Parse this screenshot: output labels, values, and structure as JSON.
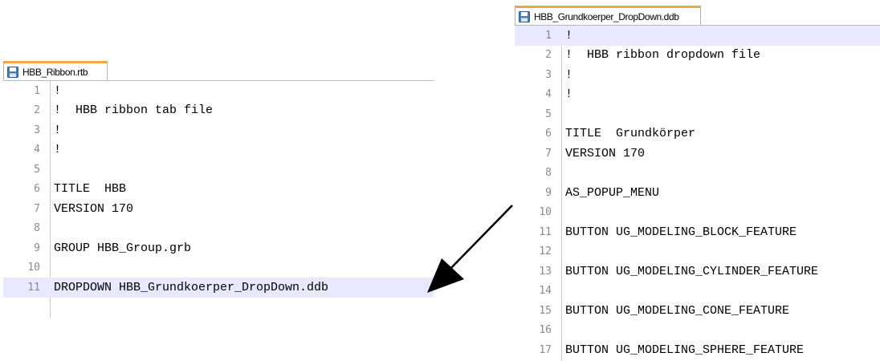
{
  "left_editor": {
    "tab_title": "HBB_Ribbon.rtb",
    "tab_icon": "floppy-disk-icon",
    "highlight_line": 11,
    "lines": [
      {
        "num": "1",
        "text": "!"
      },
      {
        "num": "2",
        "text": "!  HBB ribbon tab file"
      },
      {
        "num": "3",
        "text": "!"
      },
      {
        "num": "4",
        "text": "!"
      },
      {
        "num": "5",
        "text": ""
      },
      {
        "num": "6",
        "text": "TITLE  HBB"
      },
      {
        "num": "7",
        "text": "VERSION 170"
      },
      {
        "num": "8",
        "text": ""
      },
      {
        "num": "9",
        "text": "GROUP HBB_Group.grb"
      },
      {
        "num": "10",
        "text": ""
      },
      {
        "num": "11",
        "text": "DROPDOWN HBB_Grundkoerper_DropDown.ddb"
      }
    ]
  },
  "right_editor": {
    "tab_title": "HBB_Grundkoerper_DropDown.ddb",
    "tab_icon": "floppy-disk-icon",
    "highlight_line": 1,
    "lines": [
      {
        "num": "1",
        "text": "!"
      },
      {
        "num": "2",
        "text": "!  HBB ribbon dropdown file"
      },
      {
        "num": "3",
        "text": "!"
      },
      {
        "num": "4",
        "text": "!"
      },
      {
        "num": "5",
        "text": ""
      },
      {
        "num": "6",
        "text": "TITLE  Grundkörper"
      },
      {
        "num": "7",
        "text": "VERSION 170"
      },
      {
        "num": "8",
        "text": ""
      },
      {
        "num": "9",
        "text": "AS_POPUP_MENU"
      },
      {
        "num": "10",
        "text": ""
      },
      {
        "num": "11",
        "text": "BUTTON UG_MODELING_BLOCK_FEATURE"
      },
      {
        "num": "12",
        "text": ""
      },
      {
        "num": "13",
        "text": "BUTTON UG_MODELING_CYLINDER_FEATURE"
      },
      {
        "num": "14",
        "text": ""
      },
      {
        "num": "15",
        "text": "BUTTON UG_MODELING_CONE_FEATURE"
      },
      {
        "num": "16",
        "text": ""
      },
      {
        "num": "17",
        "text": "BUTTON UG_MODELING_SPHERE_FEATURE"
      }
    ]
  },
  "colors": {
    "tab_accent": "#f5a442",
    "highlight": "#e8e8ff",
    "line_number": "#8a8a8a"
  }
}
